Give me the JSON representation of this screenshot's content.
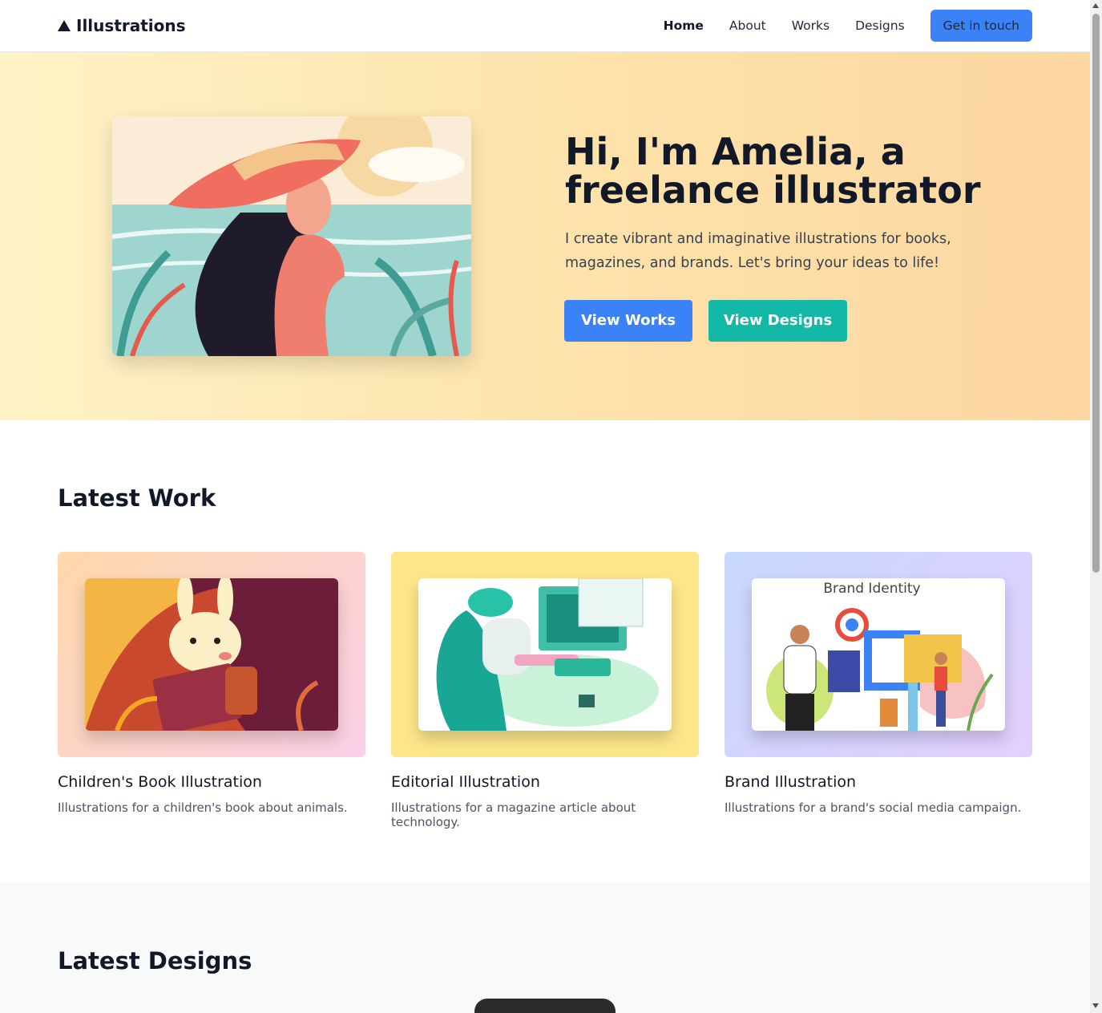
{
  "brand": {
    "name": "Illustrations",
    "icon": "triangle-logo-icon"
  },
  "nav": {
    "items": [
      {
        "label": "Home",
        "active": true
      },
      {
        "label": "About",
        "active": false
      },
      {
        "label": "Works",
        "active": false
      },
      {
        "label": "Designs",
        "active": false
      }
    ],
    "cta_label": "Get in touch"
  },
  "hero": {
    "title": "Hi, I'm Amelia, a freelance illustrator",
    "subtitle": "I create vibrant and imaginative illustrations for books, magazines, and brands. Let's bring your ideas to life!",
    "primary_button": "View Works",
    "secondary_button": "View Designs"
  },
  "latest_work": {
    "title": "Latest Work",
    "cards": [
      {
        "title": "Children's Book Illustration",
        "description": "Illustrations for a children's book about animals."
      },
      {
        "title": "Editorial Illustration",
        "description": "Illustrations for a magazine article about technology."
      },
      {
        "title": "Brand Illustration",
        "description": "Illustrations for a brand's social media campaign.",
        "image_text": "Brand Identity"
      }
    ]
  },
  "latest_designs": {
    "title": "Latest Designs"
  },
  "colors": {
    "accent_blue": "#3b82f6",
    "accent_teal": "#14b8a6",
    "hero_bg": "#fde2aa"
  }
}
